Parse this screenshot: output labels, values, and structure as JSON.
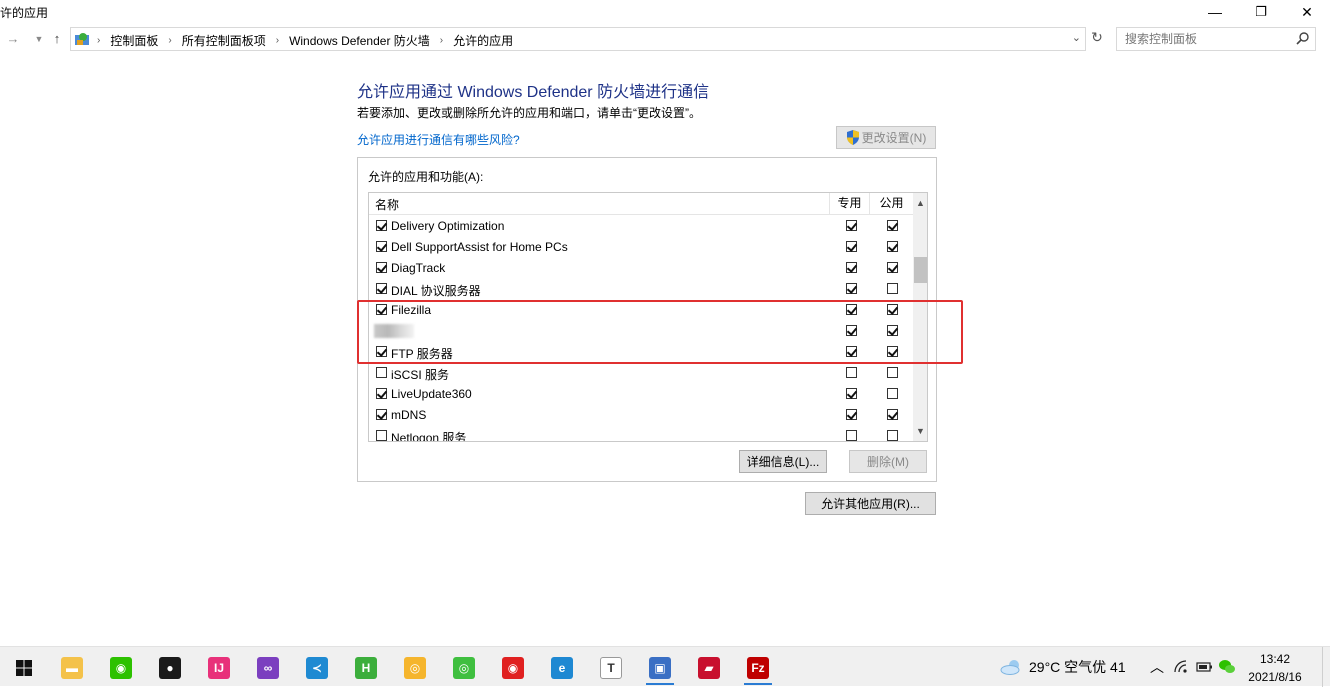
{
  "window": {
    "title": "许的应用",
    "minimize": "—",
    "restore": "❐",
    "close": "✕"
  },
  "nav": {
    "breadcrumbs": [
      "控制面板",
      "所有控制面板项",
      "Windows Defender 防火墙",
      "允许的应用"
    ],
    "search_placeholder": "搜索控制面板"
  },
  "main": {
    "title": "允许应用通过 Windows Defender 防火墙进行通信",
    "description": "若要添加、更改或删除所允许的应用和端口，请单击“更改设置”。",
    "risk_link": "允许应用进行通信有哪些风险?",
    "change_settings_button": "更改设置(N)",
    "list_label": "允许的应用和功能(A):",
    "columns": {
      "name": "名称",
      "private": "专用",
      "public": "公用"
    },
    "apps": [
      {
        "name": "Delivery Optimization",
        "enabled": true,
        "private": true,
        "public": true
      },
      {
        "name": "Dell SupportAssist for Home PCs",
        "enabled": true,
        "private": true,
        "public": true
      },
      {
        "name": "DiagTrack",
        "enabled": true,
        "private": true,
        "public": true
      },
      {
        "name": "DIAL 协议服务器",
        "enabled": true,
        "private": true,
        "public": false
      },
      {
        "name": "Filezilla",
        "enabled": true,
        "private": true,
        "public": true
      },
      {
        "name": "",
        "enabled": true,
        "private": true,
        "public": true,
        "redacted": true
      },
      {
        "name": "FTP 服务器",
        "enabled": true,
        "private": true,
        "public": true
      },
      {
        "name": "iSCSI 服务",
        "enabled": false,
        "private": false,
        "public": false
      },
      {
        "name": "LiveUpdate360",
        "enabled": true,
        "private": true,
        "public": false
      },
      {
        "name": "mDNS",
        "enabled": true,
        "private": true,
        "public": true
      },
      {
        "name": "Netlogon 服务",
        "enabled": false,
        "private": false,
        "public": false
      }
    ],
    "details_button": "详细信息(L)...",
    "remove_button": "删除(M)",
    "allow_other_button": "允许其他应用(R)..."
  },
  "taskbar": {
    "apps": [
      {
        "name": "file-explorer",
        "color": "#f4c24a",
        "glyph": "▬"
      },
      {
        "name": "wechat",
        "color": "#2dc100",
        "glyph": "◉"
      },
      {
        "name": "qq",
        "color": "#1a1a1a",
        "glyph": "●"
      },
      {
        "name": "intellij",
        "color": "#e8317a",
        "glyph": "IJ"
      },
      {
        "name": "visual-studio",
        "color": "#7b3fbf",
        "glyph": "∞"
      },
      {
        "name": "vscode",
        "color": "#1f8ad2",
        "glyph": "≺"
      },
      {
        "name": "hbuilder",
        "color": "#3cae3c",
        "glyph": "H"
      },
      {
        "name": "baidu-netdisk",
        "color": "#f5b52d",
        "glyph": "◎"
      },
      {
        "name": "iqiyi",
        "color": "#3fbf3f",
        "glyph": "◎"
      },
      {
        "name": "netease-music",
        "color": "#e02020",
        "glyph": "◉"
      },
      {
        "name": "edge",
        "color": "#1e88d2",
        "glyph": "e"
      },
      {
        "name": "typora",
        "color": "#ffffff",
        "glyph": "T"
      },
      {
        "name": "control-panel",
        "color": "#3a6fc4",
        "glyph": "▣"
      },
      {
        "name": "app-red",
        "color": "#c8102e",
        "glyph": "▰"
      },
      {
        "name": "filezilla",
        "color": "#bf0000",
        "glyph": "Fz"
      }
    ],
    "weather": "29°C  空气优 41",
    "time": "13:42",
    "date": "2021/8/16"
  }
}
